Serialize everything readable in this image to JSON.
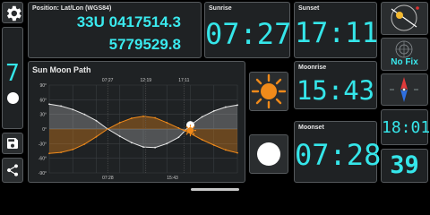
{
  "position": {
    "label": "Position: Lat/Lon (WGS84)",
    "line1": "33U 0417514.3",
    "line2": "5779529.8"
  },
  "sunrise": {
    "label": "Sunrise",
    "time": "07:27"
  },
  "sunset": {
    "label": "Sunset",
    "time": "17:11"
  },
  "moonrise": {
    "label": "Moonrise",
    "time": "15:43"
  },
  "moonset": {
    "label": "Moonset",
    "time": "07:28"
  },
  "gps": {
    "status": "No Fix"
  },
  "clock": {
    "time": "18:01"
  },
  "week": {
    "number": "39"
  },
  "left_widget": {
    "value": "7"
  },
  "chart_data": {
    "type": "line",
    "title": "Sun Moon Path",
    "top_tick_labels": [
      "07:27",
      "12:19",
      "17:11"
    ],
    "bottom_tick_labels": [
      "07:28",
      "15:43"
    ],
    "y_tick_labels": [
      "90°",
      "60°",
      "30°",
      "0°",
      "-30°",
      "-60°",
      "-90°"
    ],
    "ylim": [
      -90,
      90
    ],
    "xlim": [
      0,
      24
    ],
    "x_hours": [
      0,
      1.5,
      3,
      4.5,
      6,
      7.45,
      9,
      10.5,
      12,
      13.5,
      15,
      16.5,
      18,
      19.5,
      21,
      22.5,
      24
    ],
    "series": [
      {
        "color": "#e8e8e8",
        "values": [
          51,
          47,
          40,
          30,
          17,
          0,
          -15,
          -28,
          -37,
          -38,
          -30,
          -17,
          8,
          25,
          37,
          45,
          49
        ]
      },
      {
        "color": "#f08a1a",
        "values": [
          -50,
          -48,
          -42,
          -31,
          -16,
          0,
          13,
          22,
          26,
          23,
          13,
          2,
          -9,
          -22,
          -33,
          -43,
          -49
        ]
      }
    ],
    "markers": {
      "moon": {
        "x": 18,
        "y": 8
      },
      "sun": {
        "x": 18,
        "y": -3
      }
    },
    "grid": true
  },
  "colors": {
    "digits": "#35e6ea",
    "sun_curve": "#f08a1a",
    "moon_curve": "#e8e8e8",
    "gps_status": "#3ae9ee",
    "panel_border": "#55595c"
  },
  "icons": {
    "settings": "gear-icon",
    "save": "save-icon",
    "share": "share-icon",
    "compass": "compass-icon",
    "radar": "satellite-radar-icon",
    "sun": "sun-icon",
    "moon": "moon-icon"
  }
}
